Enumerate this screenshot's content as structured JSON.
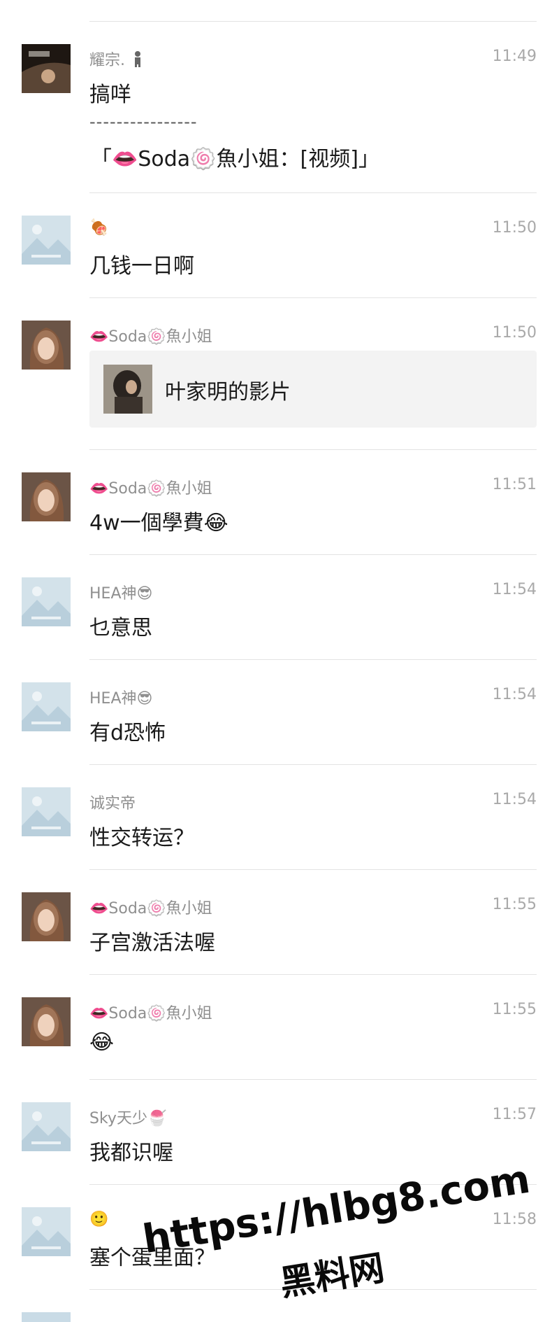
{
  "messages": [
    {
      "sender": "耀宗.",
      "time": "11:49",
      "text": "搞咩",
      "quote_sep": "----------------",
      "quote": "「👄Soda🍥魚小姐：[视频]」"
    },
    {
      "sender": "🍖",
      "time": "11:50",
      "text": "几钱一日啊"
    },
    {
      "sender": "👄Soda🍥魚小姐",
      "time": "11:50",
      "card_title": "叶家明的影片"
    },
    {
      "sender": "👄Soda🍥魚小姐",
      "time": "11:51",
      "text": "4w一個學費😂"
    },
    {
      "sender": "HEA神😎",
      "time": "11:54",
      "text": "乜意思"
    },
    {
      "sender": "HEA神😎",
      "time": "11:54",
      "text": "有d恐怖"
    },
    {
      "sender": "诚实帝",
      "time": "11:54",
      "text": "性交转运？"
    },
    {
      "sender": "👄Soda🍥魚小姐",
      "time": "11:55",
      "text": "子宫激活法喔"
    },
    {
      "sender": "👄Soda🍥魚小姐",
      "time": "11:55",
      "text": "😂"
    },
    {
      "sender": "Sky天少🍧",
      "time": "11:57",
      "text": "我都识喔"
    },
    {
      "sender": "🙂",
      "time": "11:58",
      "text": "塞个蛋里面？"
    }
  ],
  "watermark": {
    "line1": "https://hlbg8.com",
    "line2": "黑料网"
  },
  "icons": {
    "placeholder_avatar": "image-placeholder-icon",
    "person": "person-icon"
  },
  "colors": {
    "sender": "#8f8f8f",
    "time": "#a9a9a9",
    "separator": "#e3e3e3",
    "card_bg": "#f3f3f3"
  }
}
